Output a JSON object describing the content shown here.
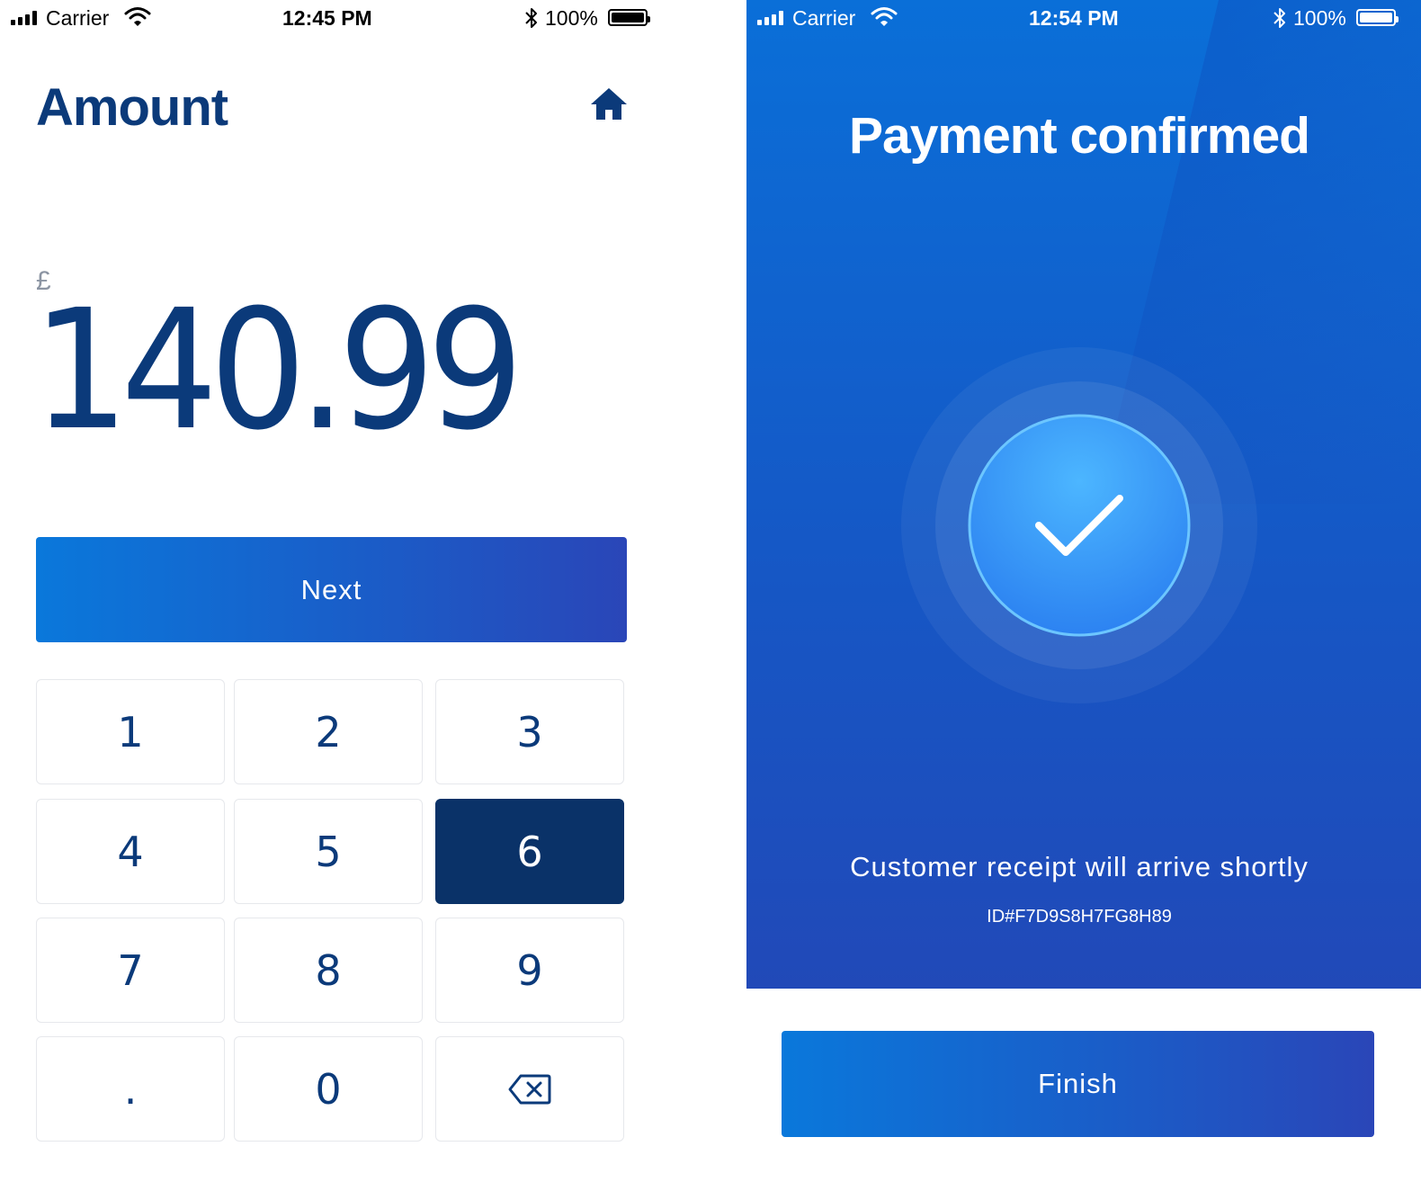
{
  "left_screen": {
    "status_bar": {
      "carrier": "Carrier",
      "time": "12:45 PM",
      "battery": "100%",
      "signal_icon": "signal-bars-icon",
      "wifi_icon": "wifi-icon",
      "bluetooth_icon": "bluetooth-icon",
      "battery_icon": "battery-icon"
    },
    "title": "Amount",
    "home_icon": "home-icon",
    "currency_symbol": "£",
    "amount": "140.99",
    "next_label": "Next",
    "keypad": {
      "keys": [
        "1",
        "2",
        "3",
        "4",
        "5",
        "6",
        "7",
        "8",
        "9",
        ".",
        "0"
      ],
      "backspace_icon": "backspace-icon",
      "pressed_key": "6"
    }
  },
  "right_screen": {
    "status_bar": {
      "carrier": "Carrier",
      "time": "12:54 PM",
      "battery": "100%",
      "signal_icon": "signal-bars-icon",
      "wifi_icon": "wifi-icon",
      "bluetooth_icon": "bluetooth-icon",
      "battery_icon": "battery-icon"
    },
    "title": "Payment confirmed",
    "check_icon": "checkmark-icon",
    "receipt_message": "Customer receipt will arrive shortly",
    "transaction_id": "ID#F7D9S8H7FG8H89",
    "finish_label": "Finish"
  },
  "colors": {
    "brand_navy": "#0b3a7a",
    "button_gradient_start": "#0a78db",
    "button_gradient_end": "#2a46b8",
    "pressed_key": "#0a3268",
    "confirm_background": "#1558c6",
    "check_circle": "#3a9cf5"
  }
}
